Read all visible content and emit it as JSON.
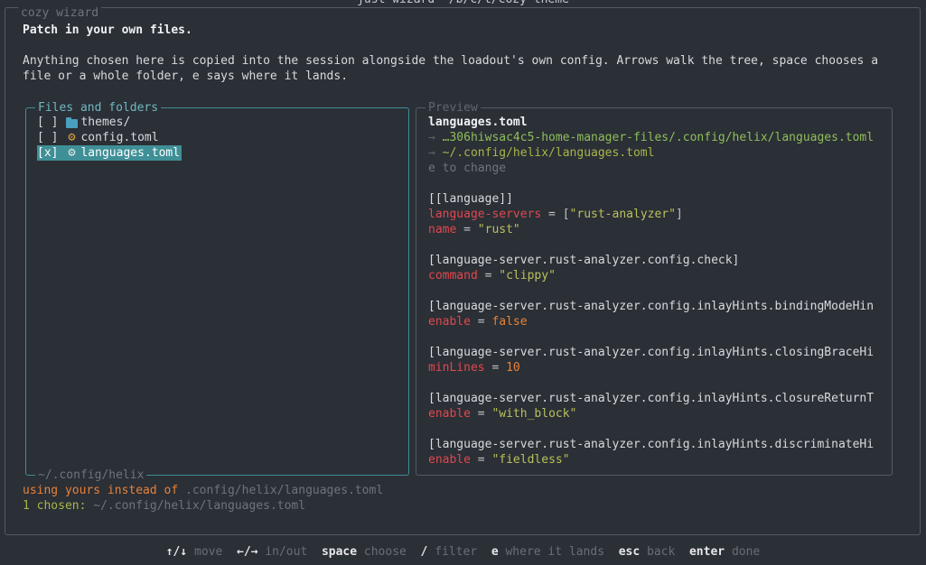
{
  "top_title": "just wizard ~/b/c/t/cozy-theme",
  "window_title": "cozy wizard",
  "heading": "Patch in your own files.",
  "description_line1": "Anything chosen here is copied into the session alongside the loadout's own config. Arrows walk the tree, space chooses a",
  "description_line2": "file or a whole folder, e says where it lands.",
  "files": {
    "title": "Files and folders",
    "path": "~/.config/helix",
    "items": [
      {
        "check": "[ ]",
        "icon": "folder-icon",
        "name": "themes/",
        "selected": false
      },
      {
        "check": "[ ]",
        "icon": "gear-icon",
        "name": "config.toml",
        "selected": false
      },
      {
        "check": "[x]",
        "icon": "gear-icon",
        "name": "languages.toml",
        "selected": true
      }
    ]
  },
  "preview": {
    "title": "Preview",
    "filename": "languages.toml",
    "source": "→ …306hiwsac4c5-home-manager-files/.config/helix/languages.toml",
    "dest": "→ ~/.config/helix/languages.toml",
    "hint": "e to change",
    "lines": [
      {
        "header": "[[language]]"
      },
      {
        "key": "language-servers",
        "op": " = ",
        "val": "[\"rust-analyzer\"]",
        "type": "arr"
      },
      {
        "key": "name",
        "op": " = ",
        "val": "\"rust\"",
        "type": "str"
      },
      {
        "header": "[language-server.rust-analyzer.config.check]"
      },
      {
        "key": "command",
        "op": " = ",
        "val": "\"clippy\"",
        "type": "str"
      },
      {
        "header": "[language-server.rust-analyzer.config.inlayHints.bindingModeHin"
      },
      {
        "key": "enable",
        "op": " = ",
        "val": "false",
        "type": "num"
      },
      {
        "header": "[language-server.rust-analyzer.config.inlayHints.closingBraceHi"
      },
      {
        "key": "minLines",
        "op": " = ",
        "val": "10",
        "type": "num"
      },
      {
        "header": "[language-server.rust-analyzer.config.inlayHints.closureReturnT"
      },
      {
        "key": "enable",
        "op": " = ",
        "val": "\"with_block\"",
        "type": "str"
      },
      {
        "header": "[language-server.rust-analyzer.config.inlayHints.discriminateHi"
      },
      {
        "key": "enable",
        "op": " = ",
        "val": "\"fieldless\"",
        "type": "str"
      }
    ]
  },
  "status": {
    "override_prefix": "using yours instead of ",
    "override_path": ".config/helix/languages.toml",
    "chosen_prefix": "1 chosen: ",
    "chosen_path": "~/.config/helix/languages.toml"
  },
  "footer": [
    {
      "key": "↑/↓",
      "desc": "move"
    },
    {
      "key": "←/→",
      "desc": "in/out"
    },
    {
      "key": "space",
      "desc": "choose"
    },
    {
      "key": "/",
      "desc": "filter"
    },
    {
      "key": "e",
      "desc": "where it lands"
    },
    {
      "key": "esc",
      "desc": "back"
    },
    {
      "key": "enter",
      "desc": "done"
    }
  ],
  "colors": {
    "background": "#2b2f36",
    "accent_teal": "#3f8f97",
    "toml_key": "#e0484f",
    "toml_string": "#b9c15a",
    "toml_number": "#e8823a",
    "path_green": "#8fbf5a"
  }
}
